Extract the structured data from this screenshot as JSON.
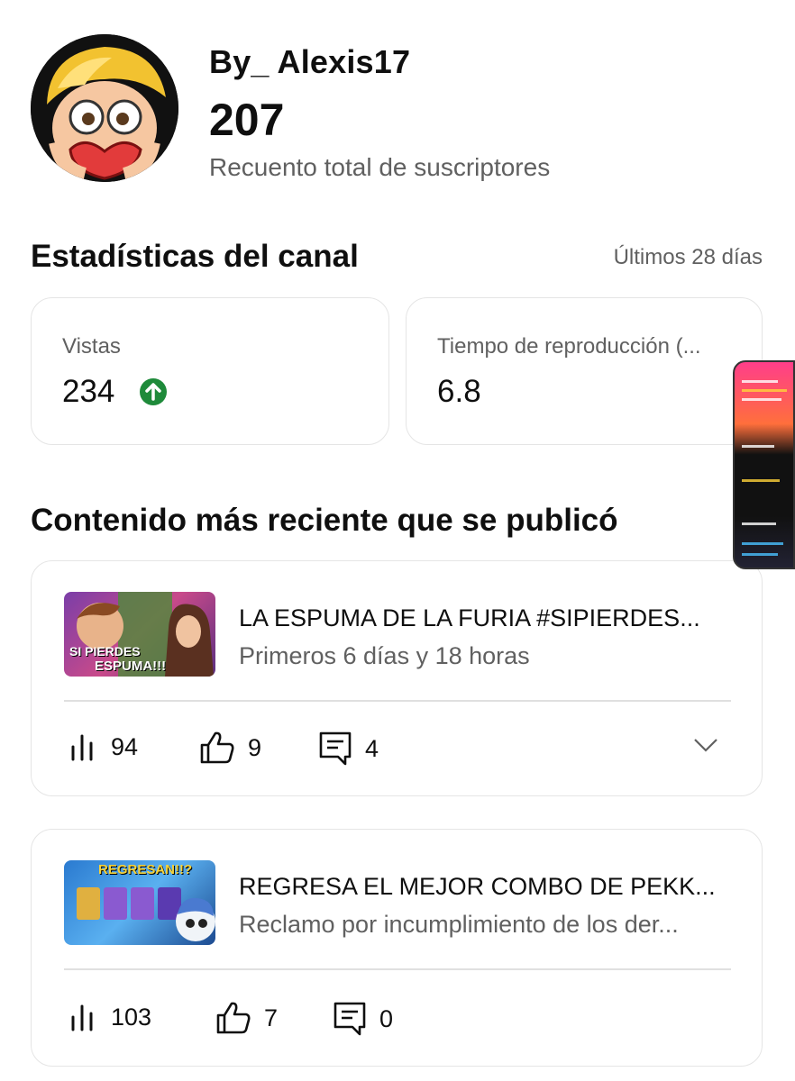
{
  "channel": {
    "name": "By_ Alexis17",
    "subscriber_count": "207",
    "subscriber_label": "Recuento total de suscriptores"
  },
  "stats": {
    "title": "Estadísticas del canal",
    "period": "Últimos 28 días",
    "cards": [
      {
        "label": "Vistas",
        "value": "234",
        "trend": "up"
      },
      {
        "label": "Tiempo de reproducción (...",
        "value": "6.8"
      }
    ]
  },
  "recent": {
    "title": "Contenido más reciente que se publicó",
    "videos": [
      {
        "title": "LA ESPUMA DE LA FURIA #SIPIERDES...",
        "subtitle": "Primeros 6 días y 18 horas",
        "thumb_text_1": "SI PIERDES",
        "thumb_text_2": "ESPUMA!!!",
        "views": "94",
        "likes": "9",
        "comments": "4"
      },
      {
        "title": "REGRESA EL MEJOR COMBO DE PEKK...",
        "subtitle": "Reclamo por incumplimiento de los der...",
        "thumb_text_1": "REGRESAN!!?",
        "views": "103",
        "likes": "7",
        "comments": "0"
      }
    ]
  },
  "colors": {
    "trend_up": "#1e8a3a",
    "secondary_text": "#606060",
    "border": "#e5e5e5"
  },
  "icons": {
    "views": "bar-chart-icon",
    "likes": "thumbs-up-icon",
    "comments": "comment-icon",
    "expand": "chevron-down-icon"
  }
}
